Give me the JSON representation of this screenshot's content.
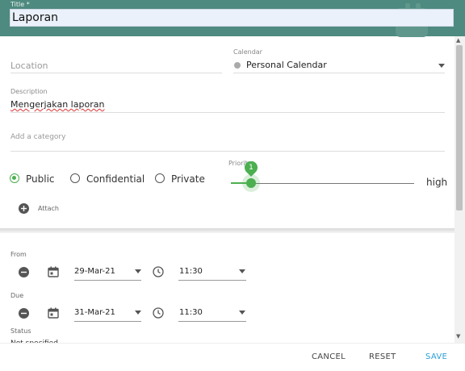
{
  "header": {
    "title_label": "Title *",
    "title_value": "Laporan"
  },
  "form": {
    "location_placeholder": "Location",
    "calendar_label": "Calendar",
    "calendar_value": "Personal Calendar",
    "description_label": "Description",
    "description_value": "Mengerjakan laporan",
    "category_placeholder": "Add a category",
    "privacy_options": [
      "Public",
      "Confidential",
      "Private"
    ],
    "privacy_selected": "Public",
    "priority_label": "Priority",
    "priority_value": "1",
    "priority_high_label": "high",
    "attach_label": "Attach"
  },
  "schedule": {
    "from_label": "From",
    "from_date": "29-Mar-21",
    "from_time": "11:30",
    "due_label": "Due",
    "due_date": "31-Mar-21",
    "due_time": "11:30",
    "status_label": "Status",
    "status_value": "Not specified"
  },
  "actions": {
    "cancel": "CANCEL",
    "reset": "RESET",
    "save": "SAVE"
  },
  "colors": {
    "header": "#4e8a7f",
    "accent_green": "#4caf50",
    "save_blue": "#2a9fd6"
  }
}
